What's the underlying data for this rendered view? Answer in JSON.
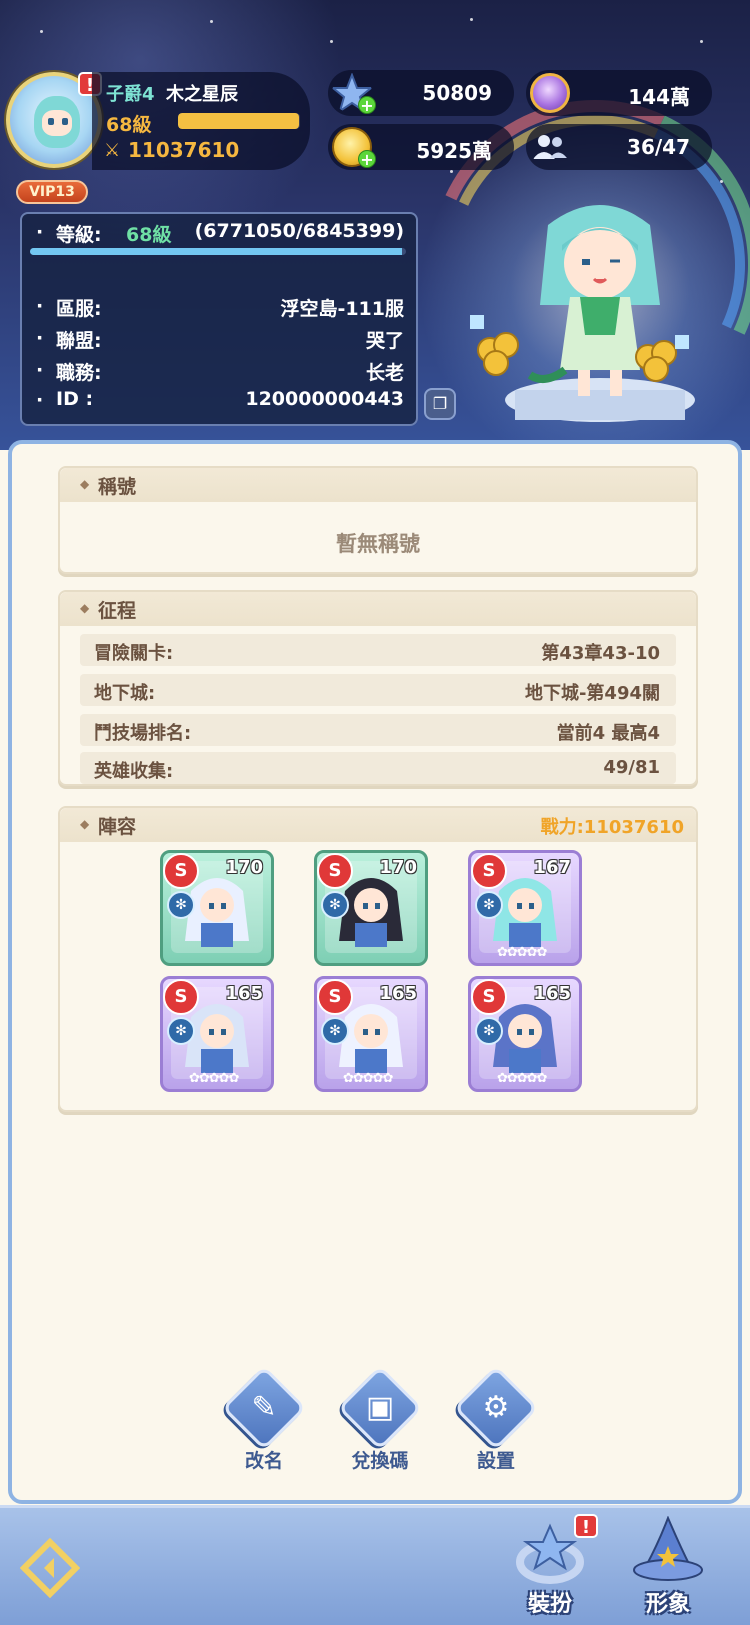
{
  "header": {
    "title_rank": "子爵4",
    "player_name": "木之星辰",
    "level": "68級",
    "exp_fraction": 0.99,
    "power": "11037610",
    "vip": "VIP13"
  },
  "currencies": {
    "stars": "50809",
    "gems": "144萬",
    "gold": "5925萬",
    "friends": "36/47"
  },
  "info": {
    "level_label": "等級:",
    "level_value": "68級",
    "exp_value": "(6771050/6845399)",
    "server_label": "區服:",
    "server_value": "浮空島-111服",
    "guild_label": "聯盟:",
    "guild_value": "哭了",
    "role_label": "職務:",
    "role_value": "长老",
    "id_label": "ID :",
    "id_value": "120000000443"
  },
  "title_card": {
    "heading": "稱號",
    "empty": "暫無稱號"
  },
  "journey_card": {
    "heading": "征程",
    "rows": [
      {
        "label": "冒險關卡:",
        "value": "第43章43-10"
      },
      {
        "label": "地下城:",
        "value": "地下城-第494關"
      },
      {
        "label": "鬥技場排名:",
        "value": "當前4 最高4"
      },
      {
        "label": "英雄收集:",
        "value": "49/81"
      }
    ]
  },
  "lineup_card": {
    "heading": "陣容",
    "power_label": "戰力:11037610",
    "heroes": [
      {
        "level": "170",
        "frame": "green"
      },
      {
        "level": "170",
        "frame": "green"
      },
      {
        "level": "167",
        "frame": "purple"
      },
      {
        "level": "165",
        "frame": "purple"
      },
      {
        "level": "165",
        "frame": "purple"
      },
      {
        "level": "165",
        "frame": "purple"
      }
    ]
  },
  "actions": {
    "rename": "改名",
    "redeem": "兌換碼",
    "settings": "設置"
  },
  "bottom_nav": {
    "dressup": "裝扮",
    "appearance": "形象"
  },
  "colors": {
    "accent_gold": "#f5b740",
    "panel_border": "#8eb3e3",
    "action_blue": "#4d74bd"
  }
}
